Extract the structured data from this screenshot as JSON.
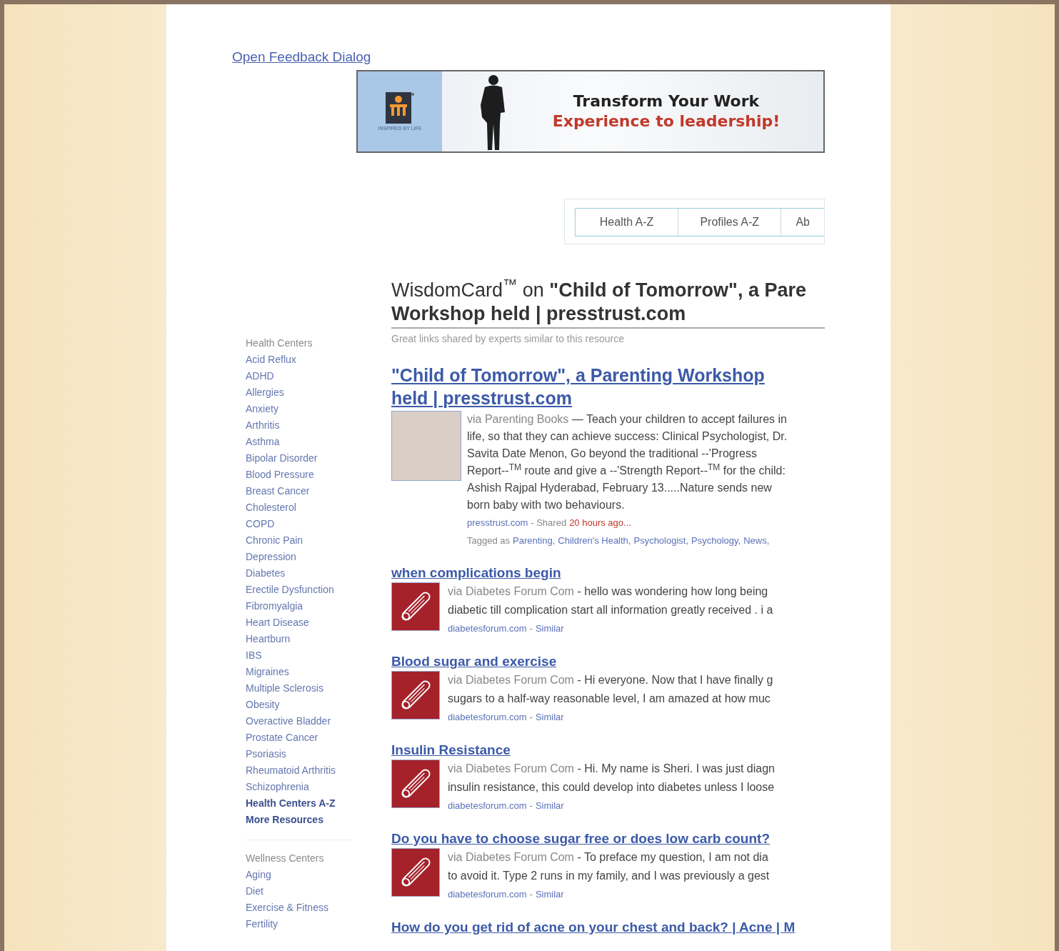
{
  "feedback_link": "Open Feedback Dialog",
  "banner": {
    "tagline": "INSPIRED BY LIFE",
    "headline": "Transform Your Work",
    "subline": "Experience to leadership!"
  },
  "tabs": [
    {
      "label": "Health A-Z"
    },
    {
      "label": "Profiles A-Z"
    },
    {
      "label": "Ab"
    }
  ],
  "heading": {
    "line_1": "WisdomCard$^{™}$ on **\"Child of Tomorrow\", a Pare**",
    "line_2": "Workshop held | presstrust.com",
    "subtitle": "Great links shared by experts similar to this resource"
  },
  "sidebar": [
    {
      "title": "Health Centers",
      "items": [
        {
          "label": "Acid Reflux",
          "kind": "link"
        },
        {
          "label": "ADHD",
          "kind": "link"
        },
        {
          "label": "Allergies",
          "kind": "link"
        },
        {
          "label": "Anxiety",
          "kind": "link"
        },
        {
          "label": "Arthritis",
          "kind": "link"
        },
        {
          "label": "Asthma",
          "kind": "link"
        },
        {
          "label": "Bipolar Disorder",
          "kind": "link"
        },
        {
          "label": "Blood Pressure",
          "kind": "link"
        },
        {
          "label": "Breast Cancer",
          "kind": "link"
        },
        {
          "label": "Cholesterol",
          "kind": "link"
        },
        {
          "label": "COPD",
          "kind": "link"
        },
        {
          "label": "Chronic Pain",
          "kind": "link"
        },
        {
          "label": "Depression",
          "kind": "link"
        },
        {
          "label": "Diabetes",
          "kind": "link"
        },
        {
          "label": "Erectile Dysfunction",
          "kind": "link"
        },
        {
          "label": "Fibromyalgia",
          "kind": "link"
        },
        {
          "label": "Heart Disease",
          "kind": "link"
        },
        {
          "label": "Heartburn",
          "kind": "link"
        },
        {
          "label": "IBS",
          "kind": "link"
        },
        {
          "label": "Migraines",
          "kind": "link"
        },
        {
          "label": "Multiple Sclerosis",
          "kind": "link"
        },
        {
          "label": "Obesity",
          "kind": "link"
        },
        {
          "label": "Overactive Bladder",
          "kind": "link"
        },
        {
          "label": "Prostate Cancer",
          "kind": "link"
        },
        {
          "label": "Psoriasis",
          "kind": "link"
        },
        {
          "label": "Rheumatoid Arthritis",
          "kind": "link"
        },
        {
          "label": "Schizophrenia",
          "kind": "link"
        },
        {
          "label": "Health Centers A-Z",
          "kind": "bold"
        },
        {
          "label": "More Resources",
          "kind": "bold"
        }
      ]
    },
    {
      "title": "Wellness Centers",
      "items": [
        {
          "label": "Aging",
          "kind": "link"
        },
        {
          "label": "Diet",
          "kind": "link"
        },
        {
          "label": "Exercise & Fitness",
          "kind": "link"
        },
        {
          "label": "Fertility",
          "kind": "link"
        }
      ]
    }
  ],
  "featured": {
    "title": "\"Child of Tomorrow\", a Parenting Workshop held | presstrust.com",
    "source": "via Parenting Books",
    "snippet": "— Teach your children to accept failures in life, so that they can achieve success: Clinical Psychologist, Dr. Savita Date Menon, Go beyond the traditional --'Progress Report--$^{TM}$ route and give a --'Strength Report--$^{TM}$ for the child: Ashish Rajpal Hyderabad, February 13.....Nature sends new born baby with two behaviours.",
    "domain": "presstrust.com",
    "shared": "- Shared",
    "time": "20 hours ago...",
    "tagged": "Tagged as",
    "tags": [
      "Parenting,",
      "Children's Health,",
      "Psychologist,",
      "Psychology,",
      "News,"
    ]
  },
  "results": [
    {
      "title": "when complications begin",
      "source": "via Diabetes Forum Com",
      "lines": [
        "- hello was wondering how long being",
        "diabetic till complication start all information greatly received . i a"
      ],
      "domain": "diabetesforum.com",
      "separator": "-",
      "similar": "Similar"
    },
    {
      "title": "Blood sugar and exercise",
      "source": "via Diabetes Forum Com",
      "lines": [
        "- Hi everyone. Now that I have finally g",
        "sugars to a half-way reasonable level, I am amazed at how muc"
      ],
      "domain": "diabetesforum.com",
      "separator": "-",
      "similar": "Similar"
    },
    {
      "title": "Insulin Resistance",
      "source": "via Diabetes Forum Com",
      "lines": [
        "- Hi. My name is Sheri. I was just diagn",
        "insulin resistance, this could develop into diabetes unless I loose"
      ],
      "domain": "diabetesforum.com",
      "separator": "-",
      "similar": "Similar"
    },
    {
      "title": "Do you have to choose sugar free or does low carb count?",
      "source": "via Diabetes Forum Com",
      "lines": [
        "- To preface my question, I am not dia",
        "to avoid it. Type 2 runs in my family, and I was previously a gest"
      ],
      "domain": "diabetesforum.com",
      "separator": "-",
      "similar": "Similar"
    }
  ],
  "last_result_title": "How do you get rid of acne on your chest and back? | Acne | M"
}
